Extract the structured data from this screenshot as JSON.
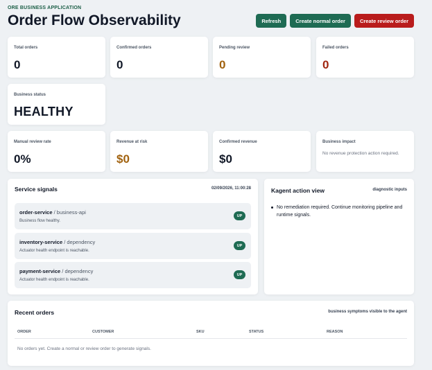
{
  "header": {
    "eyebrow": "ORE BUSINESS APPLICATION",
    "title": "Order Flow Observability",
    "actions": {
      "refresh": "Refresh",
      "create_normal": "Create normal order",
      "create_review": "Create review order"
    }
  },
  "stats": {
    "total_orders": {
      "label": "Total orders",
      "value": "0"
    },
    "confirmed_orders": {
      "label": "Confirmed orders",
      "value": "0"
    },
    "pending_review": {
      "label": "Pending review",
      "value": "0"
    },
    "failed_orders": {
      "label": "Failed orders",
      "value": "0"
    },
    "business_status": {
      "label": "Business status",
      "value": "HEALTHY"
    },
    "manual_review_rate": {
      "label": "Manual review rate",
      "value": "0%"
    },
    "revenue_at_risk": {
      "label": "Revenue at risk",
      "value": "$0"
    },
    "confirmed_revenue": {
      "label": "Confirmed revenue",
      "value": "$0"
    },
    "business_impact": {
      "label": "Business impact",
      "note": "No revenue protection action required."
    }
  },
  "colors": {
    "primary_green": "#1e6b53",
    "danger_red": "#b91c1c",
    "warning_orange": "#a1620f",
    "failed_red": "#a1260f",
    "page_background": "#eef1f4"
  },
  "service_signals": {
    "title": "Service signals",
    "timestamp": "02/09/2026, 11:00:28",
    "services": [
      {
        "name": "order-service",
        "separator": " / ",
        "role": "business-api",
        "description": "Business flow healthy.",
        "status": "UP"
      },
      {
        "name": "inventory-service",
        "separator": " / ",
        "role": "dependency",
        "description": "Actuator health endpoint is reachable.",
        "status": "UP"
      },
      {
        "name": "payment-service",
        "separator": " / ",
        "role": "dependency",
        "description": "Actuator health endpoint is reachable.",
        "status": "UP"
      }
    ]
  },
  "kagent": {
    "title": "Kagent action view",
    "meta": "diagnostic inputs",
    "bullets": [
      "No remediation required. Continue monitoring pipeline and runtime signals."
    ]
  },
  "recent_orders": {
    "title": "Recent orders",
    "meta": "business symptoms visible to the agent",
    "columns": [
      "ORDER",
      "CUSTOMER",
      "SKU",
      "STATUS",
      "REASON"
    ],
    "empty_message": "No orders yet. Create a normal or review order to generate signals."
  }
}
